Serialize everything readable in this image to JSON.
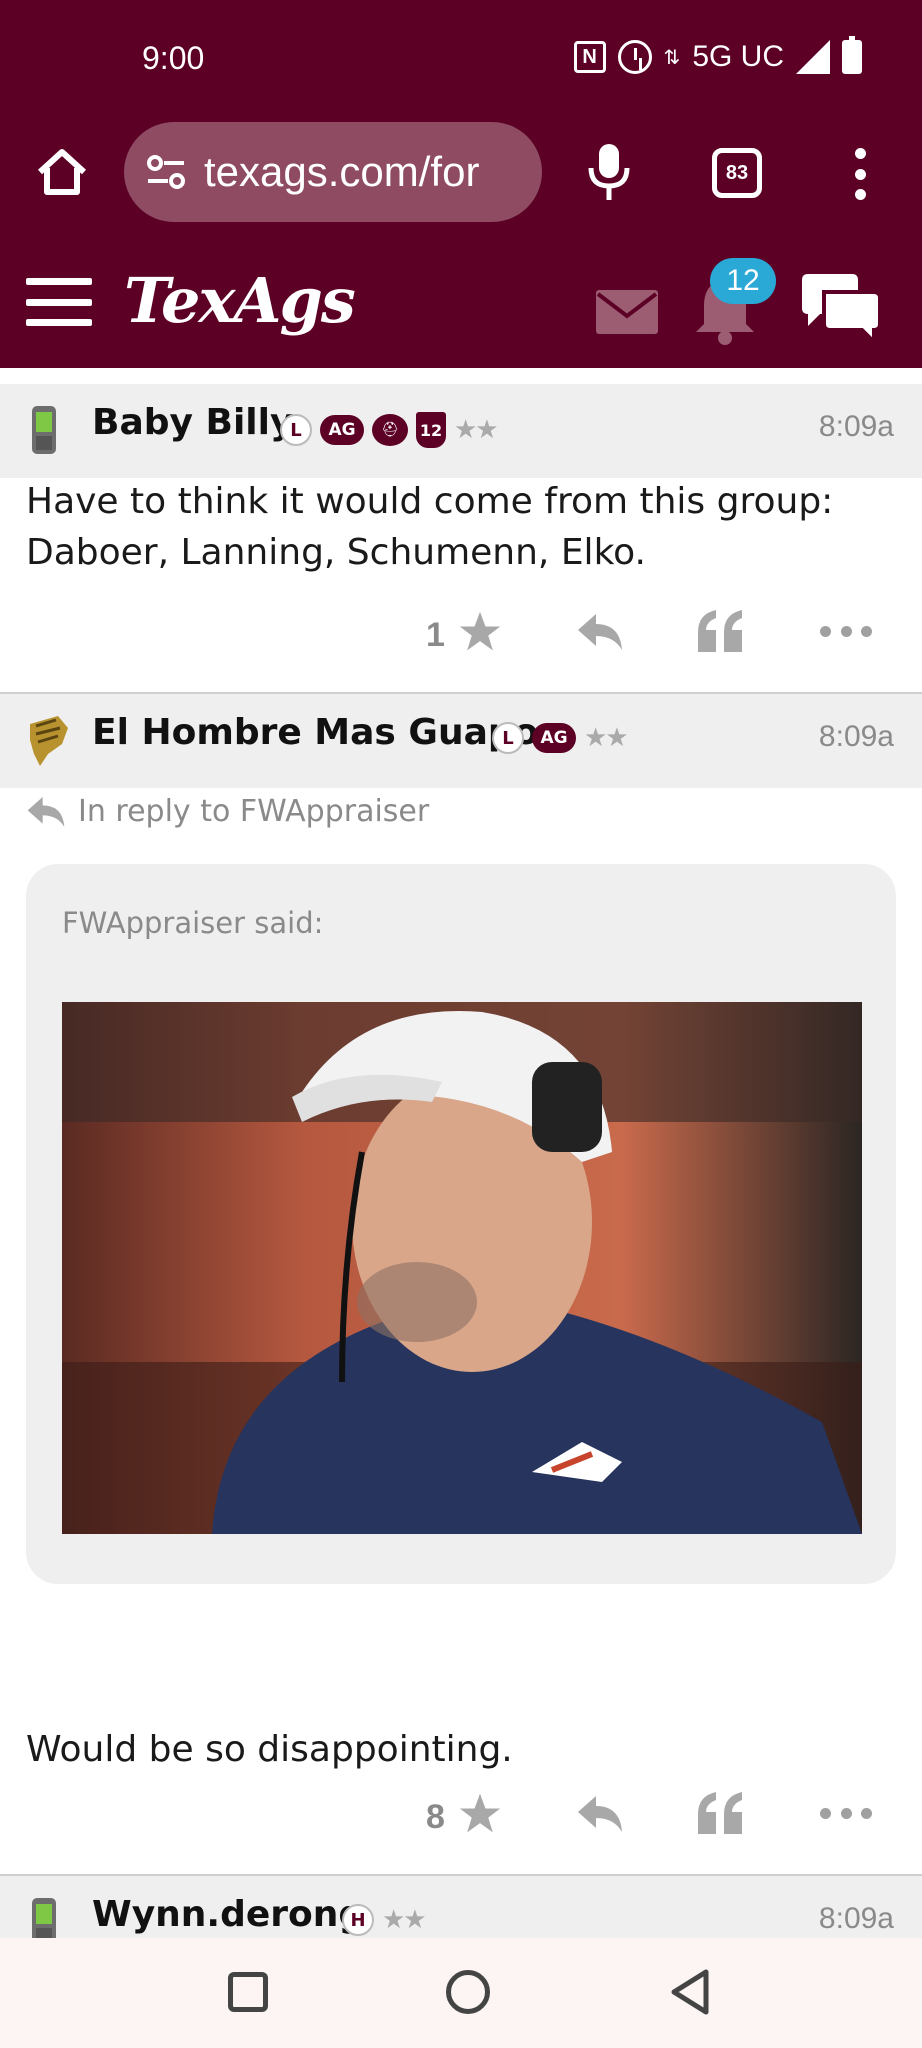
{
  "status_bar": {
    "time": "9:00",
    "network": "5G UC",
    "nfc_label": "N",
    "icons": [
      "nfc-icon",
      "alarm-icon",
      "data-arrows-icon",
      "signal-icon",
      "battery-charging-icon"
    ]
  },
  "browser": {
    "url_main": "texags.com/for",
    "tab_count": "83",
    "icons": [
      "home-icon",
      "site-settings-icon",
      "mic-icon",
      "tabs-icon",
      "overflow-menu-icon"
    ]
  },
  "site_header": {
    "logo": "TexAgs",
    "notification_count": "12",
    "icons": [
      "hamburger-icon",
      "mail-icon",
      "bell-icon",
      "chat-icon"
    ]
  },
  "posts": [
    {
      "username": "Baby Billy",
      "badges": [
        "L",
        "AG",
        "",
        "12"
      ],
      "stars": "★★",
      "time": "8:09a",
      "body_lines": [
        "Have to think it would come from this group:",
        "Daboer, Lanning, Schumenn, Elko."
      ],
      "star_count": "1"
    },
    {
      "username": "El Hombre Mas Guapo",
      "badges": [
        "L",
        "AG"
      ],
      "stars": "★★",
      "time": "8:09a",
      "in_reply_to": "In reply to FWAppraiser",
      "quote_said": "FWAppraiser said:",
      "body": "Would be so disappointing.",
      "star_count": "8"
    },
    {
      "username": "Wynn.derong",
      "badges": [
        "H"
      ],
      "stars": "★★",
      "time": "8:09a"
    }
  ],
  "colors": {
    "brand_maroon": "#5c0025",
    "url_pill": "#8e4b62",
    "badge_blue": "#2aa9d6",
    "header_gray": "#efefef",
    "muted_text": "#8a8a8a"
  },
  "android_nav": {
    "icons": [
      "recents-square-icon",
      "home-circle-icon",
      "back-triangle-icon"
    ]
  }
}
